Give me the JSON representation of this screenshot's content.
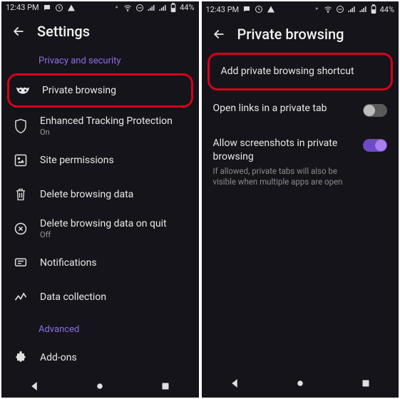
{
  "statusbar": {
    "time": "12:43 PM",
    "battery": "44%"
  },
  "left": {
    "title": "Settings",
    "section_privacy": "Privacy and security",
    "rows": {
      "private_browsing": "Private browsing",
      "etp": {
        "label": "Enhanced Tracking Protection",
        "sub": "On"
      },
      "site_permissions": "Site permissions",
      "delete_data": "Delete browsing data",
      "delete_on_quit": {
        "label": "Delete browsing data on quit",
        "sub": "Off"
      },
      "notifications": "Notifications",
      "data_collection": "Data collection"
    },
    "section_advanced": "Advanced",
    "addons": "Add-ons"
  },
  "right": {
    "title": "Private browsing",
    "rows": {
      "add_shortcut": "Add private browsing shortcut",
      "open_private": "Open links in a private tab",
      "screenshots": {
        "label": "Allow screenshots in private browsing",
        "sub": "If allowed, private tabs will also be visible when multiple apps are open"
      }
    }
  }
}
